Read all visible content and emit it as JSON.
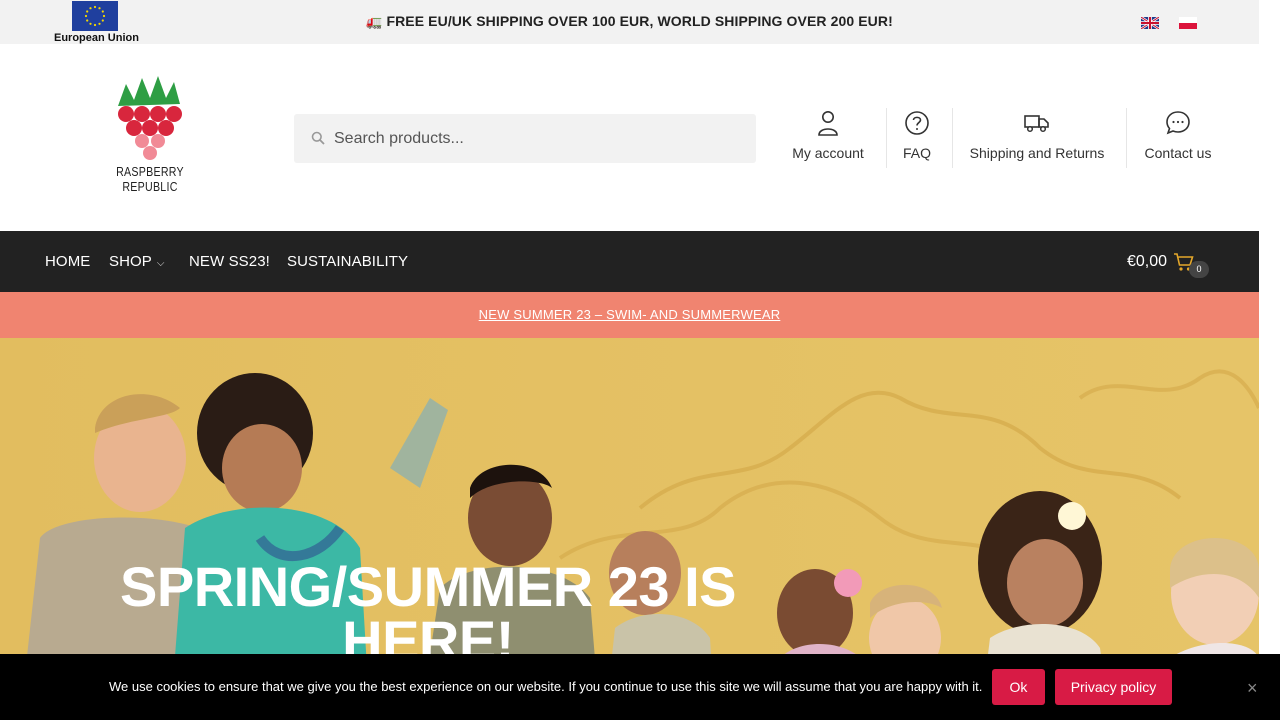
{
  "topbar": {
    "eu_label": "European Union",
    "promo_icon": "truck-icon",
    "promo": "FREE EU/UK SHIPPING OVER 100 EUR, WORLD SHIPPING OVER 200 EUR!",
    "languages": [
      "uk-flag-icon",
      "pl-flag-icon"
    ]
  },
  "header": {
    "logo_line1": "RASPBERRY",
    "logo_line2": "REPUBLIC",
    "search": {
      "placeholder": "Search products..."
    },
    "links": [
      {
        "label": "My account",
        "icon": "user-icon"
      },
      {
        "label": "FAQ",
        "icon": "question-icon"
      },
      {
        "label": "Shipping and Returns",
        "icon": "truck-icon"
      },
      {
        "label": "Contact us",
        "icon": "chat-icon"
      }
    ]
  },
  "nav": {
    "items": [
      {
        "label": "HOME"
      },
      {
        "label": "SHOP",
        "has_dropdown": true
      },
      {
        "label": "NEW SS23!"
      },
      {
        "label": "SUSTAINABILITY"
      }
    ],
    "cart": {
      "total": "€0,00",
      "count": "0"
    }
  },
  "announcement": {
    "label": "NEW SUMMER 23 – SWIM- AND SUMMERWEAR"
  },
  "hero": {
    "title": "SPRING/SUMMER 23 IS HERE!"
  },
  "cookie": {
    "text": "We use cookies to ensure that we give you the best experience on our website. If you continue to use this site we will assume that you are happy with it.",
    "ok_label": "Ok",
    "privacy_label": "Privacy policy",
    "close_label": "×"
  },
  "colors": {
    "nav_bg": "#222222",
    "announcement_bg": "#f08470",
    "hero_bg": "#e3c063",
    "button_bg": "#d81b45"
  }
}
